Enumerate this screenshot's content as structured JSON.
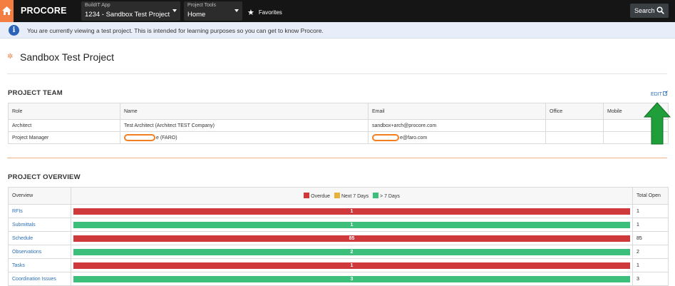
{
  "topbar": {
    "logo": "PROCORE",
    "app_label": "BuildIT App",
    "project": "1234 - Sandbox Test Project",
    "tools_label": "Project Tools",
    "tool": "Home",
    "favorites": "Favorites",
    "search": "Search"
  },
  "banner": {
    "text": "You are currently viewing a test project. This is intended for learning purposes so you can get to know Procore."
  },
  "page": {
    "title": "Sandbox Test Project"
  },
  "team": {
    "section_title": "PROJECT TEAM",
    "edit": "EDIT",
    "columns": [
      "Role",
      "Name",
      "Email",
      "Office",
      "Mobile"
    ],
    "rows": [
      {
        "role": "Architect",
        "name": "Test Architect (Architect TEST Company)",
        "email": "sandbox+arch@procore.com"
      },
      {
        "role": "Project Manager",
        "name": "e (FARO)",
        "email": "e@faro.com"
      }
    ]
  },
  "overview": {
    "section_title": "PROJECT OVERVIEW",
    "col_overview": "Overview",
    "col_total": "Total Open",
    "legend": [
      {
        "label": "Overdue",
        "color": "#d0393b"
      },
      {
        "label": "Next 7 Days",
        "color": "#e8b23a"
      },
      {
        "label": "> 7 Days",
        "color": "#3dbf7c"
      }
    ],
    "rows": [
      {
        "name": "RFIs",
        "value": "1",
        "status": "overdue",
        "total": "1"
      },
      {
        "name": "Submittals",
        "value": "1",
        "status": "later",
        "total": "1"
      },
      {
        "name": "Schedule",
        "value": "85",
        "status": "overdue",
        "total": "85"
      },
      {
        "name": "Observations",
        "value": "2",
        "status": "later",
        "total": "2"
      },
      {
        "name": "Tasks",
        "value": "1",
        "status": "overdue",
        "total": "1"
      },
      {
        "name": "Coordination Issues",
        "value": "3",
        "status": "later",
        "total": "3"
      }
    ]
  },
  "colors": {
    "accent": "#f47e42",
    "overdue": "#d0393b",
    "next7": "#e8b23a",
    "later": "#3dbf7c",
    "link": "#2c6fb7",
    "annotation_arrow": "#1f9e3a"
  }
}
